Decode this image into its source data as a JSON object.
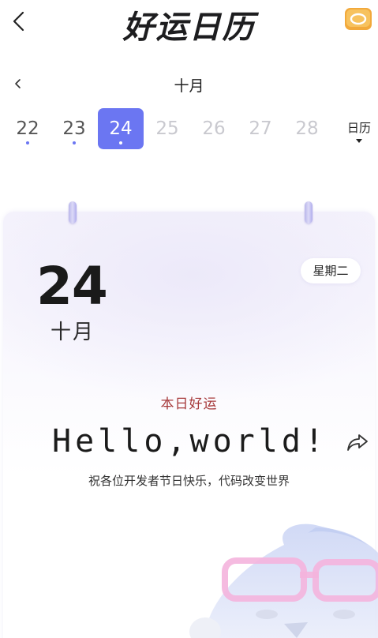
{
  "header": {
    "title": "好运日历",
    "back_icon": "chevron-left-icon",
    "coin_icon": "coin-icon"
  },
  "month_nav": {
    "prev_icon": "chevron-left-icon",
    "month": "十月"
  },
  "days": [
    {
      "num": "22",
      "state": "past",
      "dot": true
    },
    {
      "num": "23",
      "state": "past",
      "dot": true
    },
    {
      "num": "24",
      "state": "selected",
      "dot": true
    },
    {
      "num": "25",
      "state": "future",
      "dot": false
    },
    {
      "num": "26",
      "state": "future",
      "dot": false
    },
    {
      "num": "27",
      "state": "future",
      "dot": false
    },
    {
      "num": "28",
      "state": "future",
      "dot": false
    }
  ],
  "calendar_toggle": {
    "label": "日历",
    "icon": "caret-down-icon"
  },
  "card": {
    "day": "24",
    "month": "十月",
    "weekday": "星期二",
    "lucky_label": "本日好运",
    "lucky_text": "Hello,world!",
    "share_icon": "share-icon",
    "blessing": "祝各位开发者节日快乐，代码改变世界"
  },
  "colors": {
    "accent": "#6b76f2",
    "lucky_label": "#a6393a",
    "coin": "#f2a93b"
  }
}
